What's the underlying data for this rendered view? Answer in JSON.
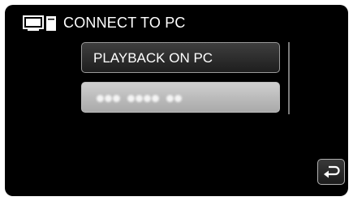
{
  "header": {
    "icon": "pc-monitor-icon",
    "title": "CONNECT TO PC"
  },
  "menu": {
    "items": [
      {
        "label": "PLAYBACK ON PC",
        "state": "normal"
      },
      {
        "label": "",
        "state": "disabled"
      }
    ]
  },
  "footer": {
    "back_icon": "return-arrow-icon"
  },
  "colors": {
    "background": "#000000",
    "text": "#ffffff",
    "button_normal": "#2a2a2a",
    "button_disabled": "#b8b8b8"
  }
}
